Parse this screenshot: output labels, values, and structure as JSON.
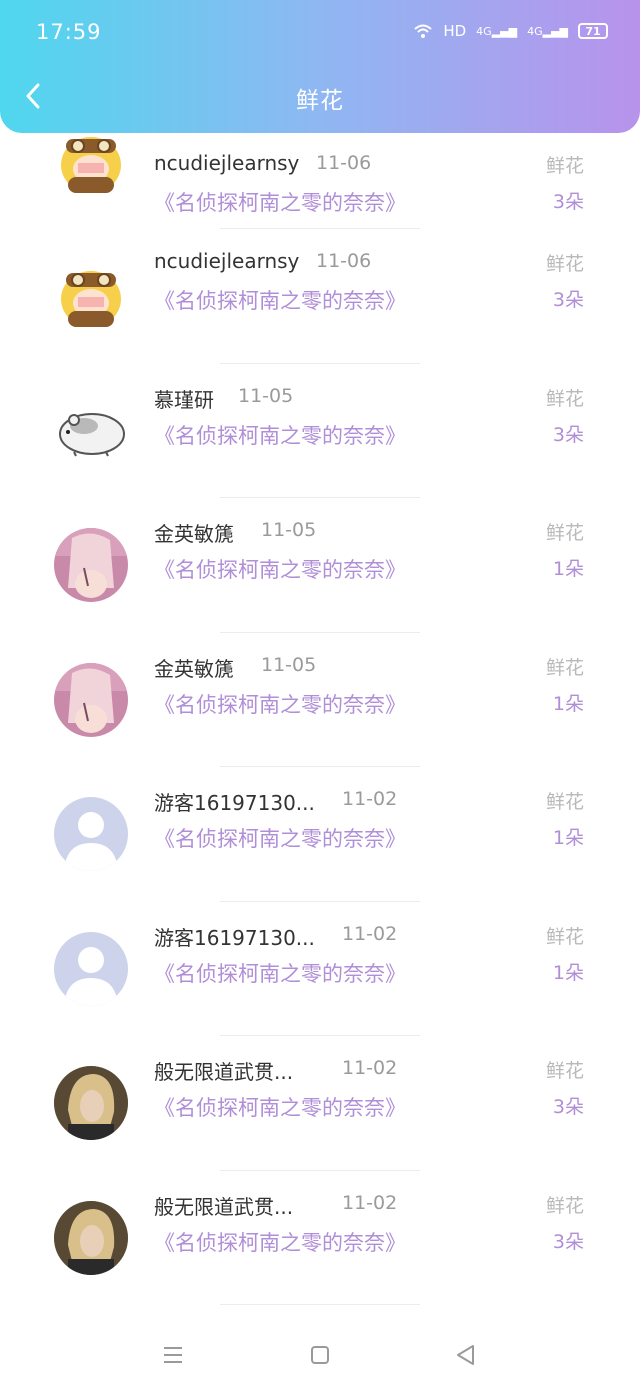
{
  "status_bar": {
    "time": "17:59",
    "network": "HD",
    "signal1": "4G",
    "signal2": "4G",
    "battery": "71"
  },
  "header": {
    "title": "鲜花"
  },
  "colors": {
    "accent": "#b08ed8",
    "header_start": "#4fd7ee",
    "header_end": "#b893ec"
  },
  "records": [
    {
      "name": "ncudiejlearnsy",
      "date": "11-06",
      "book": "《名侦探柯南之零的奈奈》",
      "gift": "鲜花",
      "count": "3朵",
      "avatar": "anime-pilot"
    },
    {
      "name": "ncudiejlearnsy",
      "date": "11-06",
      "book": "《名侦探柯南之零的奈奈》",
      "gift": "鲜花",
      "count": "3朵",
      "avatar": "anime-pilot"
    },
    {
      "name": "慕瑾研",
      "date": "11-05",
      "book": "《名侦探柯南之零的奈奈》",
      "gift": "鲜花",
      "count": "3朵",
      "avatar": "hamster"
    },
    {
      "name": "金英敏篪",
      "date": "11-05",
      "book": "《名侦探柯南之零的奈奈》",
      "gift": "鲜花",
      "count": "1朵",
      "avatar": "pink-photo"
    },
    {
      "name": "金英敏篪",
      "date": "11-05",
      "book": "《名侦探柯南之零的奈奈》",
      "gift": "鲜花",
      "count": "1朵",
      "avatar": "pink-photo"
    },
    {
      "name": "游客16197130...",
      "date": "11-02",
      "book": "《名侦探柯南之零的奈奈》",
      "gift": "鲜花",
      "count": "1朵",
      "avatar": "default-user"
    },
    {
      "name": "游客16197130...",
      "date": "11-02",
      "book": "《名侦探柯南之零的奈奈》",
      "gift": "鲜花",
      "count": "1朵",
      "avatar": "default-user"
    },
    {
      "name": "般无限道武贯...",
      "date": "11-02",
      "book": "《名侦探柯南之零的奈奈》",
      "gift": "鲜花",
      "count": "3朵",
      "avatar": "blonde-photo"
    },
    {
      "name": "般无限道武贯...",
      "date": "11-02",
      "book": "《名侦探柯南之零的奈奈》",
      "gift": "鲜花",
      "count": "3朵",
      "avatar": "blonde-photo"
    }
  ],
  "nav_bar": {
    "menu": "menu-icon",
    "home": "home-icon",
    "back": "back-triangle-icon"
  }
}
